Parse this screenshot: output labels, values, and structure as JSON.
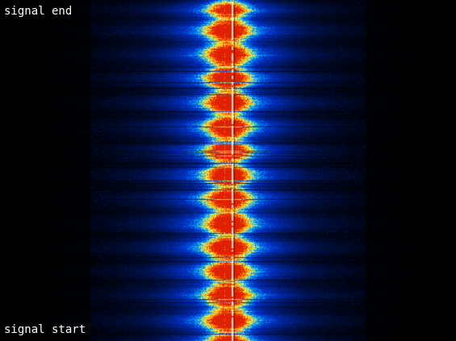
{
  "labels": {
    "top": "signal end",
    "bottom": "signal start"
  },
  "colormap": {
    "background": "#000000",
    "stops": [
      "#000000",
      "#001a6e",
      "#0033cc",
      "#00a0ff",
      "#ffff40",
      "#ff8000",
      "#e02000"
    ],
    "carrier_line": "#ffffff"
  }
}
